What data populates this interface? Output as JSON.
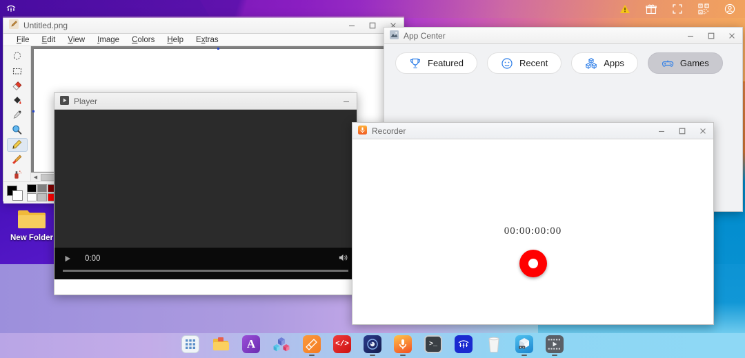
{
  "topbar": {
    "logo_icon": "system-logo-icon",
    "status_icons": [
      {
        "name": "warning-icon",
        "label": "Warning"
      },
      {
        "name": "gift-icon",
        "label": "Gifts"
      },
      {
        "name": "fullscreen-icon",
        "label": "Fullscreen"
      },
      {
        "name": "qrcode-icon",
        "label": "QR Code"
      },
      {
        "name": "account-icon",
        "label": "Account"
      }
    ]
  },
  "paint": {
    "title": "Untitled.png",
    "icon": "paint-brush-icon",
    "menu": [
      {
        "pre": "",
        "key": "F",
        "post": "ile"
      },
      {
        "pre": "",
        "key": "E",
        "post": "dit"
      },
      {
        "pre": "",
        "key": "V",
        "post": "iew"
      },
      {
        "pre": "",
        "key": "I",
        "post": "mage"
      },
      {
        "pre": "",
        "key": "C",
        "post": "olors"
      },
      {
        "pre": "",
        "key": "H",
        "post": "elp"
      },
      {
        "pre": "E",
        "key": "x",
        "post": "tras"
      }
    ],
    "tools": [
      {
        "name": "free-form-select-tool",
        "label": "Free-Form Select",
        "selected": false
      },
      {
        "name": "rectangle-select-tool",
        "label": "Select",
        "selected": false
      },
      {
        "name": "eraser-tool",
        "label": "Eraser",
        "selected": false
      },
      {
        "name": "fill-tool",
        "label": "Fill With Color",
        "selected": false
      },
      {
        "name": "eyedropper-tool",
        "label": "Pick Color",
        "selected": false
      },
      {
        "name": "magnifier-tool",
        "label": "Magnifier",
        "selected": false
      },
      {
        "name": "pencil-tool",
        "label": "Pencil",
        "selected": true
      },
      {
        "name": "brush-tool",
        "label": "Brush",
        "selected": false
      },
      {
        "name": "airbrush-tool",
        "label": "Airbrush",
        "selected": false
      }
    ],
    "foreground_color": "#000000",
    "background_color": "#ffffff",
    "palette_colors": [
      [
        "#000000",
        "#ffffff"
      ],
      [
        "#808080",
        "#c0c0c0"
      ],
      [
        "#800000",
        "#ff0000"
      ],
      [
        "#808000",
        "#ffff00"
      ]
    ],
    "window_buttons": [
      "minimize",
      "maximize",
      "close"
    ]
  },
  "app_center": {
    "title": "App Center",
    "icon": "app-center-icon",
    "tabs": [
      {
        "label": "Featured",
        "icon": "trophy-icon",
        "active": false
      },
      {
        "label": "Recent",
        "icon": "recent-clock-icon",
        "active": false
      },
      {
        "label": "Apps",
        "icon": "cubes-icon",
        "active": false
      },
      {
        "label": "Games",
        "icon": "gamepad-icon",
        "active": true
      }
    ],
    "accent_color": "#2f7fe8",
    "window_buttons": [
      "minimize",
      "maximize",
      "close"
    ]
  },
  "player": {
    "title": "Player",
    "icon": "play-box-icon",
    "time": "0:00",
    "play_icon": "play-icon",
    "volume_icon": "volume-icon",
    "progress_percent": 0,
    "window_buttons": [
      "minimize"
    ]
  },
  "recorder": {
    "title": "Recorder",
    "icon": "microphone-icon",
    "timecode": "00:00:00:00",
    "record_button": "record-button",
    "record_color": "#ff0000",
    "window_buttons": [
      "minimize",
      "maximize",
      "close"
    ]
  },
  "desktop": {
    "icons": [
      {
        "label": "New Folder",
        "icon": "folder-icon"
      }
    ]
  },
  "taskbar": {
    "items": [
      {
        "name": "app-grid-icon",
        "label": "Applications",
        "running": false
      },
      {
        "name": "file-manager-icon",
        "label": "Files",
        "running": false
      },
      {
        "name": "text-editor-icon",
        "label": "Text Editor",
        "running": false
      },
      {
        "name": "app-center-icon",
        "label": "App Center",
        "running": false
      },
      {
        "name": "paint-icon",
        "label": "Paint",
        "running": true
      },
      {
        "name": "code-editor-icon",
        "label": "Code",
        "running": false
      },
      {
        "name": "media-player-icon",
        "label": "Player",
        "running": true
      },
      {
        "name": "recorder-icon",
        "label": "Recorder",
        "running": true
      },
      {
        "name": "terminal-icon",
        "label": "Terminal",
        "running": false
      },
      {
        "name": "system-logo-icon",
        "label": "System",
        "running": false
      },
      {
        "name": "trash-icon",
        "label": "Trash",
        "running": false
      },
      {
        "name": "games-icon",
        "label": "Games",
        "running": true
      },
      {
        "name": "video-player-icon",
        "label": "Video",
        "running": true
      }
    ]
  }
}
